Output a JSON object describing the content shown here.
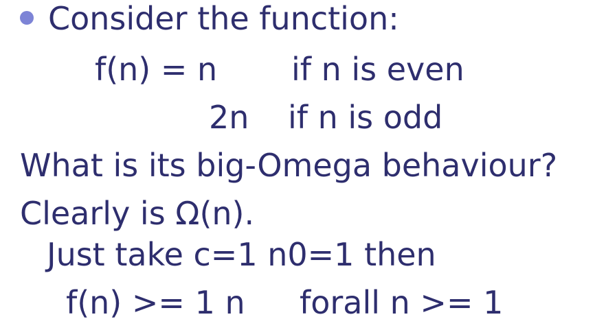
{
  "slide": {
    "bullet_text": "Consider the function:",
    "function_def": {
      "case1_expr": "f(n) = n",
      "case1_cond": "if n is even",
      "case2_expr": "2n",
      "case2_cond": "if n is odd"
    },
    "question": "What is its big-Omega behaviour?",
    "answer": "Clearly is Ω(n).",
    "justification_1": "Just take c=1 n0=1 then",
    "justification_2_lhs": "f(n) >= 1 n",
    "justification_2_rhs": "forall n >= 1"
  },
  "colors": {
    "text": "#2e2e6e",
    "bullet": "#7d84d6",
    "background": "#ffffff"
  }
}
